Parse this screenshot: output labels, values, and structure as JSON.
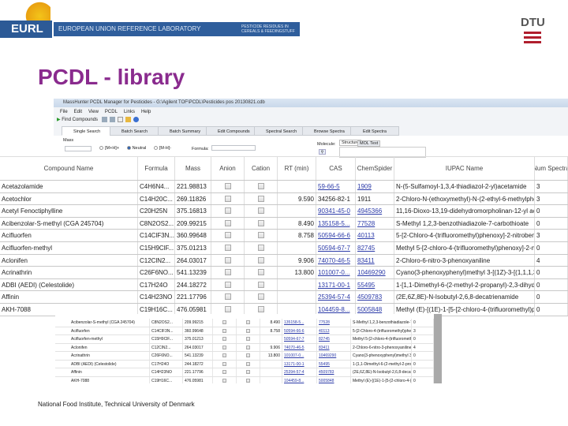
{
  "header": {
    "eurl": "EURL",
    "banner": "EUROPEAN UNION REFERENCE LABORATORY",
    "banner_sub": "PESTICIDE RESIDUES IN CEREALS & FEEDINGSTUFF",
    "dtu": "DTU"
  },
  "slide_title": "PCDL - library",
  "footer": "National Food Institute, Technical University of Denmark",
  "app": {
    "window_title": "MassHunter PCDL Manager for Pesticides - G:\\Agilent TOF\\PCDL\\Pesticides pos 20130821.cdb",
    "menu": [
      "File",
      "Edit",
      "View",
      "PCDL",
      "Links",
      "Help"
    ],
    "toolbar": {
      "find": "Find Compounds"
    },
    "tabs": [
      "Single Search",
      "Batch Search",
      "Batch Summary",
      "Edit Compounds",
      "Spectral Search",
      "Browse Spectra",
      "Edit Spectra"
    ],
    "search": {
      "mass_label": "Mass",
      "radios": [
        "[M+H]+",
        "Neutral",
        "[M-H]-"
      ],
      "selected_radio": "Neutral",
      "formula_label": "Formula:",
      "molecule_label": "Molecule:",
      "mol_tabs": [
        "Structure",
        "MOL Text"
      ]
    }
  },
  "table": {
    "columns": [
      "Compound Name",
      "Formula",
      "Mass",
      "Anion",
      "Cation",
      "RT (min)",
      "CAS",
      "ChemSpider",
      "IUPAC Name",
      "Num Spectra"
    ],
    "rows": [
      {
        "name": "Acetazolamide",
        "formula": "C4H6N4...",
        "mass": "221.98813",
        "rt": "",
        "cas": "59-66-5",
        "cs": "1909",
        "iupac": "N-(5-Sulfamoyl-1,3,4-thiadiazol-2-yl)acetamide",
        "num": "3"
      },
      {
        "name": "Acetochlor",
        "formula": "C14H20C...",
        "mass": "269.11826",
        "rt": "9.590",
        "cas": "34256-82-1",
        "cs": "1911",
        "iupac": "2-Chloro-N-(ethoxymethyl)-N-(2-ethyl-6-methylphe...",
        "num": "3"
      },
      {
        "name": "Acetyl Fenoctiphylline",
        "formula": "C20H25N",
        "mass": "375.16813",
        "rt": "",
        "cas": "90341-45-0",
        "cs": "4945366",
        "iupac": "11,16-Dioxo-13,19-didehydromorpholinan-12-yl ac...",
        "num": "0"
      },
      {
        "name": "Acibenzolar-S-methyl (CGA 245704)",
        "formula": "C8N2OS2...",
        "mass": "209.99215",
        "rt": "8.490",
        "cas": "135158-5...",
        "cs": "77528",
        "iupac": "S-Methyl 1,2,3-benzothiadiazole-7-carbothioate",
        "num": "0"
      },
      {
        "name": "Acifluorfen",
        "formula": "C14ClF3N...",
        "mass": "360.99648",
        "rt": "8.758",
        "cas": "50594-66-6",
        "cs": "40113",
        "iupac": "5-[2-Chloro-4-(trifluoromethyl)phenoxy]-2-nitrobenz...",
        "num": "3"
      },
      {
        "name": "Acifluorfen-methyl",
        "formula": "C15H9ClF...",
        "mass": "375.01213",
        "rt": "",
        "cas": "50594-67-7",
        "cs": "82745",
        "iupac": "Methyl 5-[2-chloro-4-(trifluoromethyl)phenoxy]-2-nit...",
        "num": "0"
      },
      {
        "name": "Aclonifen",
        "formula": "C12ClN2...",
        "mass": "264.03017",
        "rt": "9.906",
        "cas": "74070-46-5",
        "cs": "83411",
        "iupac": "2-Chloro-6-nitro-3-phenoxyaniline",
        "num": "4"
      },
      {
        "name": "Acrinathrin",
        "formula": "C26F6NO...",
        "mass": "541.13239",
        "rt": "13.800",
        "cas": "101007-0...",
        "cs": "10469290",
        "iupac": "Cyano(3-phenoxyphenyl)methyl 3-[(1Z)-3-[(1,1,1,3...",
        "num": "0"
      },
      {
        "name": "ADBI (AEDI) (Celestolide)",
        "formula": "C17H24O",
        "mass": "244.18272",
        "rt": "",
        "cas": "13171-00-1",
        "cs": "55495",
        "iupac": "1-[1,1-Dimethyl-6-(2-methyl-2-propanyl)-2,3-dihydr...",
        "num": "0"
      },
      {
        "name": "Affinin",
        "formula": "C14H23NO",
        "mass": "221.17796",
        "rt": "",
        "cas": "25394-57-4",
        "cs": "4509783",
        "iupac": "(2E,6Z,8E)-N-Isobutyl-2,6,8-decatrienamide",
        "num": "0"
      },
      {
        "name": "AKH-7088",
        "formula": "C19H16C...",
        "mass": "476.05981",
        "rt": "",
        "cas": "104459-8...",
        "cs": "5005848",
        "iupac": "Methyl (E)-[(1E)-1-[5-[2-chloro-4-(trifluoromethyl)phe...",
        "num": "0"
      }
    ],
    "overlay_rows_from": 3
  }
}
